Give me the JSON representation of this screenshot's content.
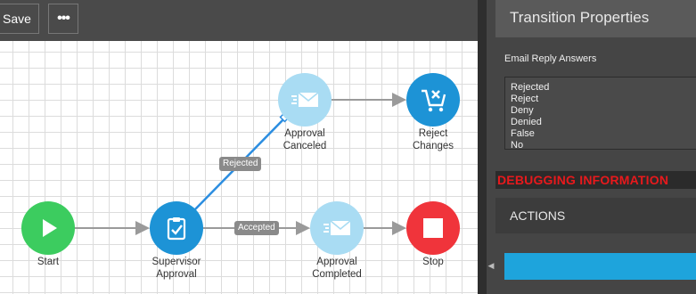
{
  "toolbar": {
    "save_label": "Save",
    "more_label": "•••"
  },
  "workflow": {
    "nodes": [
      {
        "id": "start",
        "label_lines": [
          "Start"
        ],
        "icon": "play-icon",
        "color": "#3ccc5f"
      },
      {
        "id": "supervisor",
        "label_lines": [
          "Supervisor",
          "Approval"
        ],
        "icon": "clipboard-check-icon",
        "color": "#1d93d6"
      },
      {
        "id": "approval-canceled",
        "label_lines": [
          "Approval",
          "Canceled"
        ],
        "icon": "email-send-icon",
        "color": "#a9dcf3"
      },
      {
        "id": "reject-changes",
        "label_lines": [
          "Reject",
          "Changes"
        ],
        "icon": "cart-remove-icon",
        "color": "#1d93d6"
      },
      {
        "id": "approval-completed",
        "label_lines": [
          "Approval",
          "Completed"
        ],
        "icon": "email-send-icon",
        "color": "#a9dcf3"
      },
      {
        "id": "stop",
        "label_lines": [
          "Stop"
        ],
        "icon": "stop-icon",
        "color": "#f0343b"
      }
    ],
    "edge_labels": {
      "rejected": "Rejected",
      "accepted": "Accepted"
    },
    "colors": {
      "edge": "#9a9a9a",
      "selected_edge": "#2b8de0"
    }
  },
  "panel": {
    "title": "Transition Properties",
    "email_reply_label": "Email Reply Answers",
    "answers": [
      "Rejected",
      "Reject",
      "Deny",
      "Denied",
      "False",
      "No"
    ],
    "debug_label": "DEBUGGING INFORMATION",
    "actions_label": "ACTIONS",
    "collapse_icon": "chevron-left-icon"
  }
}
